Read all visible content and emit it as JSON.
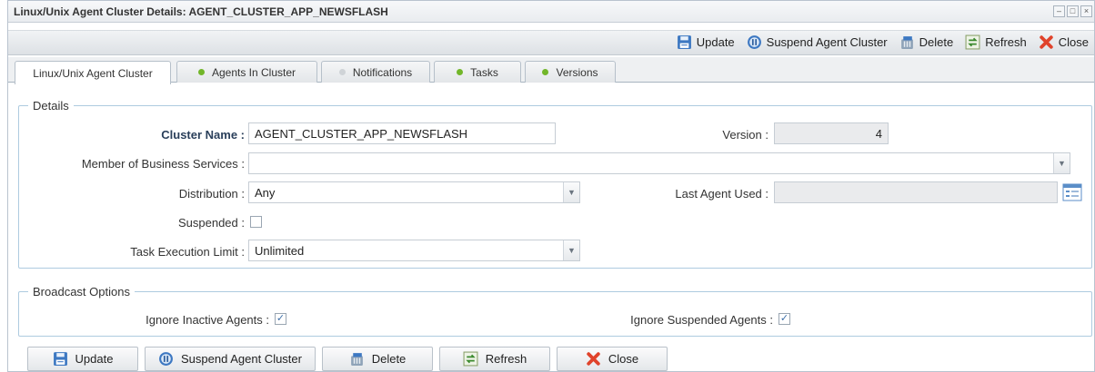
{
  "window": {
    "title": "Linux/Unix Agent Cluster Details: AGENT_CLUSTER_APP_NEWSFLASH",
    "controls": [
      "–",
      "□",
      "×"
    ]
  },
  "toolbar": {
    "update": "Update",
    "suspend": "Suspend Agent Cluster",
    "delete": "Delete",
    "refresh": "Refresh",
    "close": "Close"
  },
  "tabs": [
    {
      "label": "Linux/Unix Agent Cluster",
      "indicator": "none"
    },
    {
      "label": "Agents In Cluster",
      "indicator": "green"
    },
    {
      "label": "Notifications",
      "indicator": "gray"
    },
    {
      "label": "Tasks",
      "indicator": "green"
    },
    {
      "label": "Versions",
      "indicator": "green"
    }
  ],
  "details": {
    "legend": "Details",
    "cluster_name_label": "Cluster Name :",
    "cluster_name_value": "AGENT_CLUSTER_APP_NEWSFLASH",
    "version_label": "Version :",
    "version_value": "4",
    "member_label": "Member of Business Services :",
    "member_value": "",
    "distribution_label": "Distribution :",
    "distribution_value": "Any",
    "last_agent_label": "Last Agent Used :",
    "last_agent_value": "",
    "suspended_label": "Suspended :",
    "suspended_checked": false,
    "task_limit_label": "Task Execution Limit :",
    "task_limit_value": "Unlimited"
  },
  "broadcast": {
    "legend": "Broadcast Options",
    "ignore_inactive_label": "Ignore Inactive Agents :",
    "ignore_inactive_checked": true,
    "ignore_suspended_label": "Ignore Suspended Agents :",
    "ignore_suspended_checked": true
  },
  "bottom": {
    "update": "Update",
    "suspend": "Suspend Agent Cluster",
    "delete": "Delete",
    "refresh": "Refresh",
    "close": "Close"
  },
  "colors": {
    "accent_blue": "#3d78c2",
    "green_indicator": "#72b62a",
    "close_red": "#e0432b",
    "fieldset_border": "#aecbe0"
  },
  "icons": {
    "update": "floppy-disk-icon",
    "suspend": "pause-circle-icon",
    "delete": "trash-bin-icon",
    "refresh": "refresh-arrows-icon",
    "close": "red-x-icon",
    "last_agent_lookup": "list-lookup-icon"
  }
}
